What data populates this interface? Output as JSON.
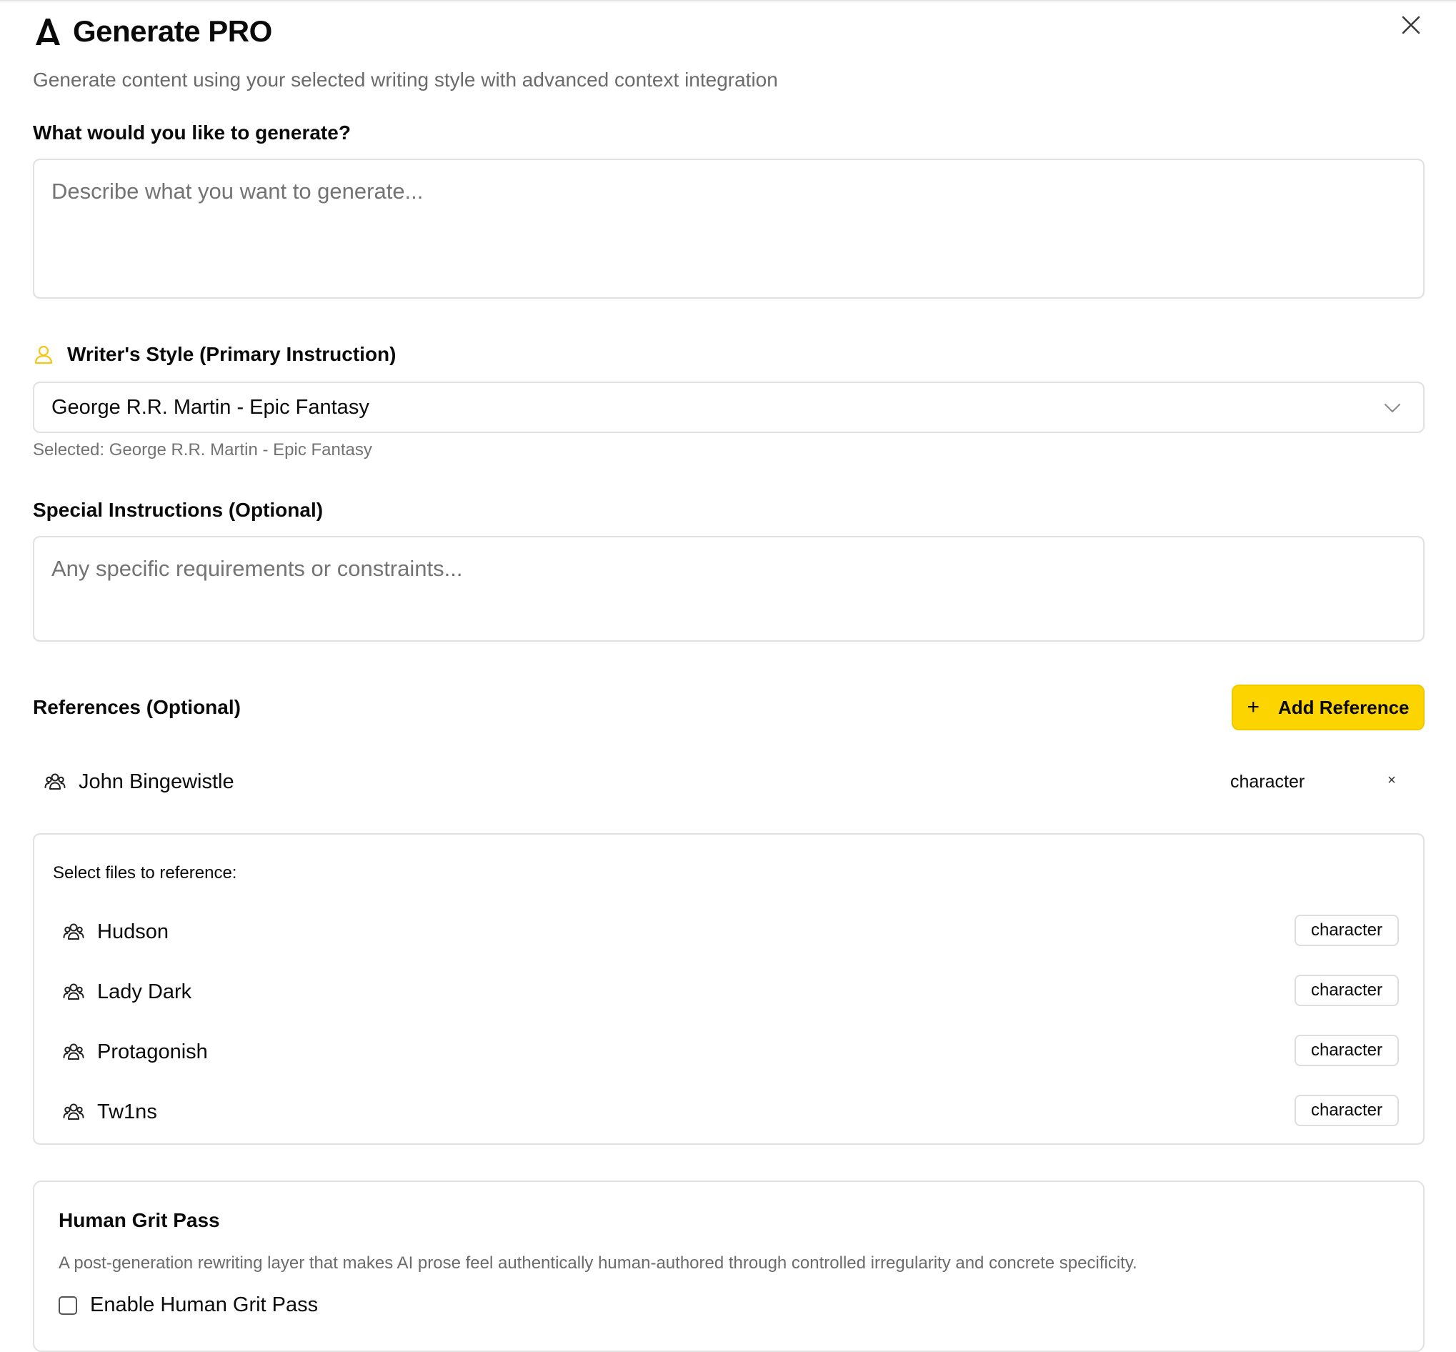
{
  "header": {
    "title": "Generate PRO",
    "subtitle": "Generate content using your selected writing style with advanced context integration"
  },
  "prompt": {
    "label": "What would you like to generate?",
    "placeholder": "Describe what you want to generate..."
  },
  "style": {
    "label": "Writer's Style (Primary Instruction)",
    "selected": "George R.R. Martin - Epic Fantasy",
    "hint": "Selected: George R.R. Martin - Epic Fantasy",
    "accent_color": "#f5c518"
  },
  "special": {
    "label": "Special Instructions (Optional)",
    "placeholder": "Any specific requirements or constraints..."
  },
  "references": {
    "label": "References (Optional)",
    "add_button_label": "Add Reference",
    "add_button_color": "#fcd500",
    "selected": [
      {
        "name": "John Bingewistle",
        "type": "character",
        "remove_label": "×"
      }
    ],
    "files_title": "Select files to reference:",
    "files": [
      {
        "name": "Hudson",
        "type": "character"
      },
      {
        "name": "Lady Dark",
        "type": "character"
      },
      {
        "name": "Protagonish",
        "type": "character"
      },
      {
        "name": "Tw1ns",
        "type": "character"
      }
    ]
  },
  "grit": {
    "title": "Human Grit Pass",
    "description": "A post-generation rewriting layer that makes AI prose feel authentically human-authored through controlled irregularity and concrete specificity.",
    "checkbox_label": "Enable Human Grit Pass",
    "checked": false
  }
}
